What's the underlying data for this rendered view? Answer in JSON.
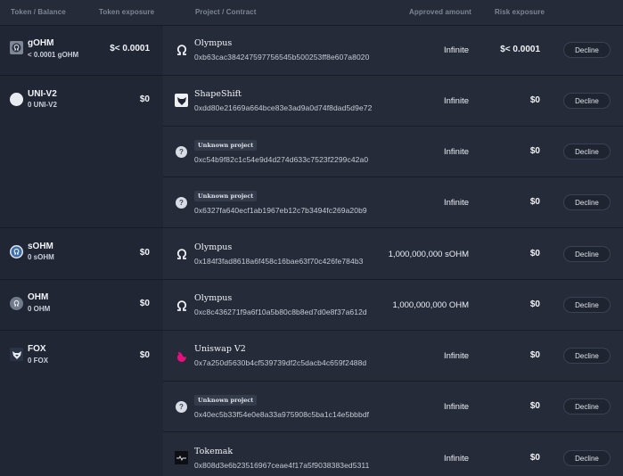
{
  "headers": {
    "token_balance": "Token / Balance",
    "token_exposure": "Token exposure",
    "project_contract": "Project / Contract",
    "approved_amount": "Approved amount",
    "risk_exposure": "Risk exposure"
  },
  "tokens": [
    {
      "name": "gOHM",
      "balance": "< 0.0001 gOHM",
      "exposure": "$< 0.0001",
      "icon": "ohm-icon"
    },
    {
      "name": "UNI-V2",
      "balance": "0 UNI-V2",
      "exposure": "$0",
      "icon": "blank-token-icon"
    },
    {
      "name": "sOHM",
      "balance": "0 sOHM",
      "exposure": "$0",
      "icon": "sohm-icon"
    },
    {
      "name": "OHM",
      "balance": "0 OHM",
      "exposure": "$0",
      "icon": "ohm-icon"
    },
    {
      "name": "FOX",
      "balance": "0 FOX",
      "exposure": "$0",
      "icon": "fox-icon"
    }
  ],
  "approvals": [
    {
      "project": "Olympus",
      "unknown": false,
      "address": "0xb63cac384247597756545b500253ff8e607a8020",
      "amount": "Infinite",
      "risk": "$< 0.0001",
      "icon": "olympus-icon"
    },
    {
      "project": "ShapeShift",
      "unknown": false,
      "address": "0xdd80e21669a664bce83e3ad9a0d74f8dad5d9e72",
      "amount": "Infinite",
      "risk": "$0",
      "icon": "shapeshift-icon"
    },
    {
      "project": "Unknown project",
      "unknown": true,
      "address": "0xc54b9f82c1c54e9d4d274d633c7523f2299c42a0",
      "amount": "Infinite",
      "risk": "$0",
      "icon": "question-icon"
    },
    {
      "project": "Unknown project",
      "unknown": true,
      "address": "0x6327fa640ecf1ab1967eb12c7b3494fc269a20b9",
      "amount": "Infinite",
      "risk": "$0",
      "icon": "question-icon"
    },
    {
      "project": "Olympus",
      "unknown": false,
      "address": "0x184f3fad8618a6f458c16bae63f70c426fe784b3",
      "amount": "1,000,000,000 sOHM",
      "risk": "$0",
      "icon": "olympus-icon"
    },
    {
      "project": "Olympus",
      "unknown": false,
      "address": "0xc8c436271f9a6f10a5b80c8b8ed7d0e8f37a612d",
      "amount": "1,000,000,000 OHM",
      "risk": "$0",
      "icon": "olympus-icon"
    },
    {
      "project": "Uniswap V2",
      "unknown": false,
      "address": "0x7a250d5630b4cf539739df2c5dacb4c659f2488d",
      "amount": "Infinite",
      "risk": "$0",
      "icon": "uniswap-icon"
    },
    {
      "project": "Unknown project",
      "unknown": true,
      "address": "0x40ec5b33f54e0e8a33a975908c5ba1c14e5bbbdf",
      "amount": "Infinite",
      "risk": "$0",
      "icon": "question-icon"
    },
    {
      "project": "Tokemak",
      "unknown": false,
      "address": "0x808d3e6b23516967ceae4f17a5f9038383ed5311",
      "amount": "Infinite",
      "risk": "$0",
      "icon": "tokemak-icon"
    }
  ],
  "decline_label": "Decline",
  "question_glyph": "?"
}
